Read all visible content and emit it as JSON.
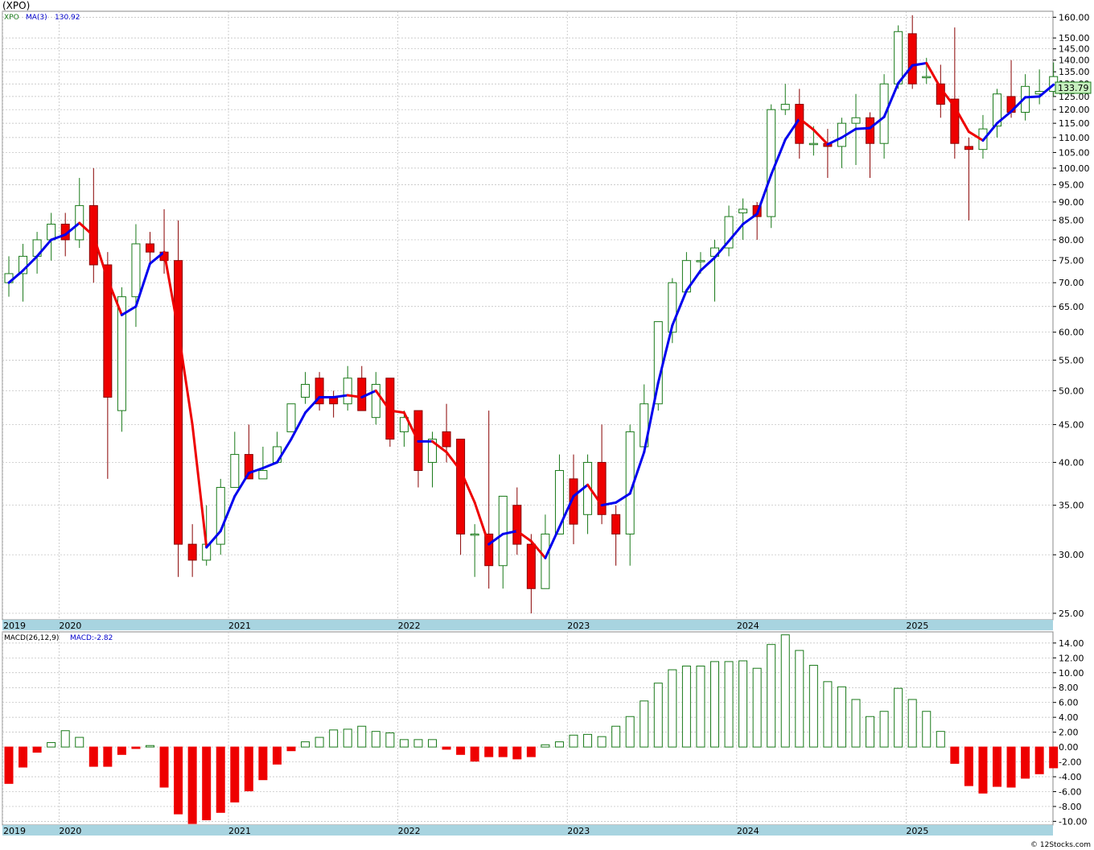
{
  "title": "(XPO)",
  "watermark": "© 12Stocks.com",
  "colors": {
    "up_body": "#ffffff",
    "up_stroke": "#1a7a1a",
    "down_body": "#ee0000",
    "down_wick": "#880000",
    "ma_up": "#0000ee",
    "ma_down": "#ee0000",
    "macd_pos_stroke": "#1a7a1a",
    "macd_neg_fill": "#ee0000",
    "axis_band": "#a8d4e0",
    "grid": "#bbbbbb",
    "last_price_bg": "#c8f0c0"
  },
  "chart_data": [
    {
      "type": "candlestick",
      "legend": {
        "symbol": "XPO",
        "ma_label": "MA(3)",
        "ma_value": "130.92"
      },
      "last_price_label": "133.79",
      "y_scale": "log",
      "ylim": [
        24.5,
        163
      ],
      "yticks": [
        25,
        30,
        35,
        40,
        45,
        50,
        55,
        60,
        65,
        70,
        75,
        80,
        85,
        90,
        95,
        100,
        105,
        110,
        115,
        120,
        125,
        130,
        135,
        140,
        145,
        150,
        160
      ],
      "ytick_labels": [
        "25.00",
        "30.00",
        "35.00",
        "40.00",
        "45.00",
        "50.00",
        "55.00",
        "60.00",
        "65.00",
        "70.00",
        "75.00",
        "80.00",
        "85.00",
        "90.00",
        "95.00",
        "100.00",
        "105.00",
        "110.00",
        "115.00",
        "120.00",
        "125.00",
        "130.00",
        "135.00",
        "140.00",
        "145.00",
        "150.00",
        "160.00"
      ],
      "x_year_labels": [
        {
          "label": "2019",
          "month_index": 0
        },
        {
          "label": "2020",
          "month_index": 4
        },
        {
          "label": "2021",
          "month_index": 16
        },
        {
          "label": "2022",
          "month_index": 28
        },
        {
          "label": "2023",
          "month_index": 40
        },
        {
          "label": "2024",
          "month_index": 52
        },
        {
          "label": "2025",
          "month_index": 64
        }
      ],
      "candles": [
        [
          70,
          72,
          67,
          76
        ],
        [
          72,
          76,
          66,
          79
        ],
        [
          76,
          80,
          72,
          82
        ],
        [
          80,
          84,
          75,
          87
        ],
        [
          84,
          80,
          76,
          87
        ],
        [
          80,
          89,
          78,
          97
        ],
        [
          89,
          74,
          70,
          100
        ],
        [
          74,
          49,
          38,
          77
        ],
        [
          47,
          67,
          44,
          69
        ],
        [
          67,
          79,
          61,
          84
        ],
        [
          79,
          77,
          74,
          82
        ],
        [
          77,
          75,
          72,
          88
        ],
        [
          75,
          31,
          28,
          85
        ],
        [
          31,
          29.5,
          28,
          33
        ],
        [
          29.5,
          31,
          29,
          35
        ],
        [
          31,
          37,
          30,
          38
        ],
        [
          37,
          41,
          37,
          44
        ],
        [
          41,
          38,
          38,
          45
        ],
        [
          38,
          39,
          38,
          42
        ],
        [
          40,
          42,
          40,
          44
        ],
        [
          44,
          48,
          44,
          48
        ],
        [
          49,
          51,
          48,
          53
        ],
        [
          52,
          48,
          47,
          53
        ],
        [
          49,
          48,
          46,
          50
        ],
        [
          48,
          52,
          47,
          54
        ],
        [
          52,
          47,
          47,
          54
        ],
        [
          46,
          51,
          45,
          53
        ],
        [
          52,
          43,
          42,
          52
        ],
        [
          44,
          46,
          42,
          47
        ],
        [
          47,
          39,
          37,
          47
        ],
        [
          40,
          43,
          37,
          44
        ],
        [
          44,
          42,
          40,
          48
        ],
        [
          43,
          32,
          30,
          43
        ],
        [
          32,
          32,
          28,
          33
        ],
        [
          32,
          29,
          27,
          47
        ],
        [
          29,
          36,
          27,
          36
        ],
        [
          35,
          31,
          30,
          37
        ],
        [
          31,
          27,
          25,
          32
        ],
        [
          27,
          32,
          27,
          34
        ],
        [
          32,
          39,
          32,
          41
        ],
        [
          38,
          33,
          31,
          41
        ],
        [
          34,
          40,
          32,
          41
        ],
        [
          40,
          34,
          33,
          45
        ],
        [
          34,
          32,
          29,
          35
        ],
        [
          32,
          44,
          29,
          45
        ],
        [
          42,
          48,
          42,
          51
        ],
        [
          48,
          62,
          47,
          62
        ],
        [
          60,
          70,
          58,
          71
        ],
        [
          68,
          75,
          68,
          77
        ],
        [
          75,
          75,
          72,
          77
        ],
        [
          76,
          78,
          66,
          80
        ],
        [
          78,
          86,
          76,
          89
        ],
        [
          87,
          88,
          80,
          91
        ],
        [
          89,
          86,
          80,
          90
        ],
        [
          86,
          120,
          83,
          122
        ],
        [
          120,
          122,
          118,
          130
        ],
        [
          122,
          108,
          103,
          128
        ],
        [
          108,
          108,
          104,
          114
        ],
        [
          108,
          107,
          97,
          113
        ],
        [
          107,
          115,
          100,
          117
        ],
        [
          115,
          117,
          101,
          126
        ],
        [
          117,
          108,
          97,
          119
        ],
        [
          108,
          130,
          103,
          134
        ],
        [
          130,
          153,
          128,
          156
        ],
        [
          152,
          130,
          128,
          161
        ],
        [
          133,
          133,
          130,
          141
        ],
        [
          130,
          122,
          117,
          138
        ],
        [
          124,
          108,
          103,
          155
        ],
        [
          107,
          106,
          85,
          110
        ],
        [
          106,
          113,
          103,
          118
        ],
        [
          114,
          126,
          110,
          128
        ],
        [
          125,
          119,
          117,
          140
        ],
        [
          119,
          129,
          116,
          134
        ],
        [
          126,
          127,
          122,
          136
        ],
        [
          127,
          133,
          125,
          139
        ]
      ],
      "ma3": [
        70,
        72.7,
        76,
        80,
        81.3,
        84.3,
        81,
        70.7,
        63.3,
        65,
        74.3,
        77,
        60.3,
        45,
        30.7,
        32.3,
        36,
        38.7,
        39.3,
        40,
        43,
        46.7,
        49,
        49,
        49.3,
        49,
        50,
        47,
        46.7,
        42.7,
        42.7,
        41.3,
        39,
        35.3,
        31,
        32,
        32.3,
        31.3,
        29.7,
        32.7,
        36,
        37.3,
        35,
        35.3,
        36.3,
        41.3,
        51.3,
        61.3,
        68.3,
        72.7,
        75.7,
        79.7,
        84,
        86.7,
        98,
        109.3,
        116.7,
        112.7,
        107.7,
        110,
        113,
        113.3,
        117.3,
        130.3,
        137.7,
        138.7,
        128.3,
        121,
        112,
        109,
        115,
        119.3,
        124.7,
        125,
        129.7
      ]
    },
    {
      "type": "bar",
      "legend": {
        "label": "MACD(26,12,9)",
        "value_label": "MACD:-2.82"
      },
      "ylim": [
        -10.5,
        15.5
      ],
      "yticks": [
        14,
        12,
        10,
        8,
        6,
        4,
        2,
        0,
        -2,
        -4,
        -6,
        -8,
        -10
      ],
      "ytick_labels": [
        "14.00",
        "12.00",
        "10.00",
        "8.00",
        "6.00",
        "4.00",
        "2.00",
        "0.00",
        "-2.00",
        "-4.00",
        "-6.00",
        "-8.00",
        "-10.00"
      ],
      "x_year_labels": [
        {
          "label": "2019",
          "month_index": 0
        },
        {
          "label": "2020",
          "month_index": 4
        },
        {
          "label": "2021",
          "month_index": 16
        },
        {
          "label": "2022",
          "month_index": 28
        },
        {
          "label": "2023",
          "month_index": 40
        },
        {
          "label": "2024",
          "month_index": 52
        },
        {
          "label": "2025",
          "month_index": 64
        }
      ],
      "values": [
        -4.9,
        -2.7,
        -0.7,
        0.6,
        2.2,
        1.3,
        -2.6,
        -2.6,
        -1.0,
        -0.2,
        0.2,
        -5.4,
        -9.0,
        -10.3,
        -9.8,
        -8.8,
        -7.4,
        -5.9,
        -4.4,
        -2.3,
        -0.5,
        0.7,
        1.3,
        2.3,
        2.4,
        2.8,
        2.1,
        1.9,
        1.0,
        1.0,
        1.0,
        -0.3,
        -1.0,
        -1.9,
        -1.3,
        -1.3,
        -1.6,
        -1.3,
        0.3,
        0.7,
        1.6,
        1.7,
        1.4,
        2.8,
        4.1,
        6.2,
        8.6,
        10.4,
        10.9,
        10.9,
        11.5,
        11.5,
        11.6,
        10.6,
        13.8,
        15.1,
        13.0,
        11.0,
        8.8,
        8.1,
        6.4,
        4.1,
        4.8,
        7.9,
        6.4,
        4.8,
        2.1,
        -2.2,
        -5.2,
        -6.2,
        -5.3,
        -5.4,
        -4.2,
        -3.6,
        -2.8
      ]
    }
  ]
}
